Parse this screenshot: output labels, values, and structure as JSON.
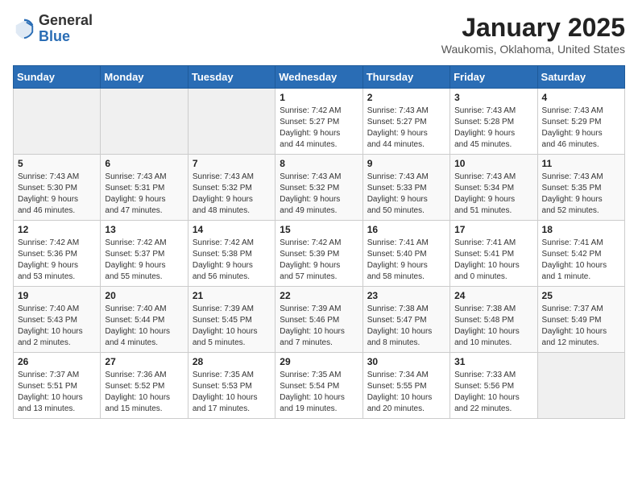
{
  "header": {
    "logo_general": "General",
    "logo_blue": "Blue",
    "month_title": "January 2025",
    "location": "Waukomis, Oklahoma, United States"
  },
  "weekdays": [
    "Sunday",
    "Monday",
    "Tuesday",
    "Wednesday",
    "Thursday",
    "Friday",
    "Saturday"
  ],
  "weeks": [
    [
      {
        "day": "",
        "info": ""
      },
      {
        "day": "",
        "info": ""
      },
      {
        "day": "",
        "info": ""
      },
      {
        "day": "1",
        "info": "Sunrise: 7:42 AM\nSunset: 5:27 PM\nDaylight: 9 hours\nand 44 minutes."
      },
      {
        "day": "2",
        "info": "Sunrise: 7:43 AM\nSunset: 5:27 PM\nDaylight: 9 hours\nand 44 minutes."
      },
      {
        "day": "3",
        "info": "Sunrise: 7:43 AM\nSunset: 5:28 PM\nDaylight: 9 hours\nand 45 minutes."
      },
      {
        "day": "4",
        "info": "Sunrise: 7:43 AM\nSunset: 5:29 PM\nDaylight: 9 hours\nand 46 minutes."
      }
    ],
    [
      {
        "day": "5",
        "info": "Sunrise: 7:43 AM\nSunset: 5:30 PM\nDaylight: 9 hours\nand 46 minutes."
      },
      {
        "day": "6",
        "info": "Sunrise: 7:43 AM\nSunset: 5:31 PM\nDaylight: 9 hours\nand 47 minutes."
      },
      {
        "day": "7",
        "info": "Sunrise: 7:43 AM\nSunset: 5:32 PM\nDaylight: 9 hours\nand 48 minutes."
      },
      {
        "day": "8",
        "info": "Sunrise: 7:43 AM\nSunset: 5:32 PM\nDaylight: 9 hours\nand 49 minutes."
      },
      {
        "day": "9",
        "info": "Sunrise: 7:43 AM\nSunset: 5:33 PM\nDaylight: 9 hours\nand 50 minutes."
      },
      {
        "day": "10",
        "info": "Sunrise: 7:43 AM\nSunset: 5:34 PM\nDaylight: 9 hours\nand 51 minutes."
      },
      {
        "day": "11",
        "info": "Sunrise: 7:43 AM\nSunset: 5:35 PM\nDaylight: 9 hours\nand 52 minutes."
      }
    ],
    [
      {
        "day": "12",
        "info": "Sunrise: 7:42 AM\nSunset: 5:36 PM\nDaylight: 9 hours\nand 53 minutes."
      },
      {
        "day": "13",
        "info": "Sunrise: 7:42 AM\nSunset: 5:37 PM\nDaylight: 9 hours\nand 55 minutes."
      },
      {
        "day": "14",
        "info": "Sunrise: 7:42 AM\nSunset: 5:38 PM\nDaylight: 9 hours\nand 56 minutes."
      },
      {
        "day": "15",
        "info": "Sunrise: 7:42 AM\nSunset: 5:39 PM\nDaylight: 9 hours\nand 57 minutes."
      },
      {
        "day": "16",
        "info": "Sunrise: 7:41 AM\nSunset: 5:40 PM\nDaylight: 9 hours\nand 58 minutes."
      },
      {
        "day": "17",
        "info": "Sunrise: 7:41 AM\nSunset: 5:41 PM\nDaylight: 10 hours\nand 0 minutes."
      },
      {
        "day": "18",
        "info": "Sunrise: 7:41 AM\nSunset: 5:42 PM\nDaylight: 10 hours\nand 1 minute."
      }
    ],
    [
      {
        "day": "19",
        "info": "Sunrise: 7:40 AM\nSunset: 5:43 PM\nDaylight: 10 hours\nand 2 minutes."
      },
      {
        "day": "20",
        "info": "Sunrise: 7:40 AM\nSunset: 5:44 PM\nDaylight: 10 hours\nand 4 minutes."
      },
      {
        "day": "21",
        "info": "Sunrise: 7:39 AM\nSunset: 5:45 PM\nDaylight: 10 hours\nand 5 minutes."
      },
      {
        "day": "22",
        "info": "Sunrise: 7:39 AM\nSunset: 5:46 PM\nDaylight: 10 hours\nand 7 minutes."
      },
      {
        "day": "23",
        "info": "Sunrise: 7:38 AM\nSunset: 5:47 PM\nDaylight: 10 hours\nand 8 minutes."
      },
      {
        "day": "24",
        "info": "Sunrise: 7:38 AM\nSunset: 5:48 PM\nDaylight: 10 hours\nand 10 minutes."
      },
      {
        "day": "25",
        "info": "Sunrise: 7:37 AM\nSunset: 5:49 PM\nDaylight: 10 hours\nand 12 minutes."
      }
    ],
    [
      {
        "day": "26",
        "info": "Sunrise: 7:37 AM\nSunset: 5:51 PM\nDaylight: 10 hours\nand 13 minutes."
      },
      {
        "day": "27",
        "info": "Sunrise: 7:36 AM\nSunset: 5:52 PM\nDaylight: 10 hours\nand 15 minutes."
      },
      {
        "day": "28",
        "info": "Sunrise: 7:35 AM\nSunset: 5:53 PM\nDaylight: 10 hours\nand 17 minutes."
      },
      {
        "day": "29",
        "info": "Sunrise: 7:35 AM\nSunset: 5:54 PM\nDaylight: 10 hours\nand 19 minutes."
      },
      {
        "day": "30",
        "info": "Sunrise: 7:34 AM\nSunset: 5:55 PM\nDaylight: 10 hours\nand 20 minutes."
      },
      {
        "day": "31",
        "info": "Sunrise: 7:33 AM\nSunset: 5:56 PM\nDaylight: 10 hours\nand 22 minutes."
      },
      {
        "day": "",
        "info": ""
      }
    ]
  ]
}
